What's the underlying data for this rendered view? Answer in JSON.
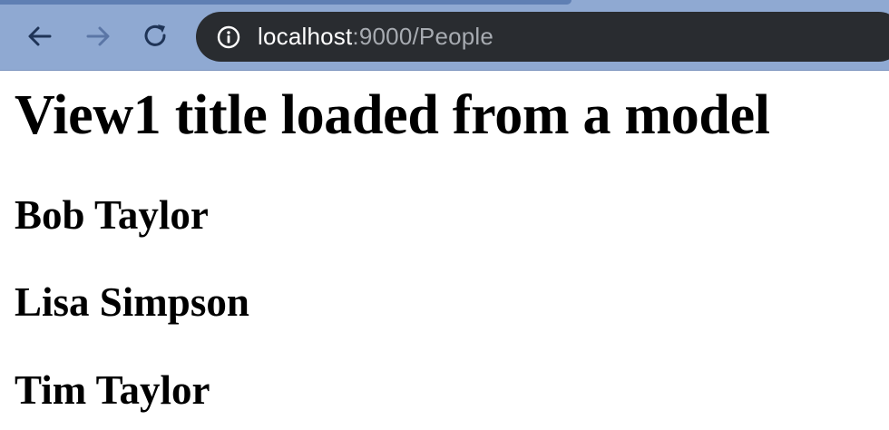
{
  "browser": {
    "url_host": "localhost",
    "url_rest": ":9000/People",
    "icons": {
      "back": "arrow-left-icon",
      "forward": "arrow-right-icon",
      "reload": "reload-icon",
      "info": "info-icon"
    },
    "colors": {
      "toolbar_bg": "#8fa9d2",
      "address_bar_bg": "#292c30",
      "url_host": "#ffffff",
      "url_rest": "#a7abb1",
      "nav_active": "#1f3457",
      "nav_inactive": "#5b76a6"
    }
  },
  "page": {
    "title": "View1 title loaded from a model",
    "people": [
      {
        "name": "Bob Taylor"
      },
      {
        "name": "Lisa Simpson"
      },
      {
        "name": "Tim Taylor"
      }
    ]
  }
}
